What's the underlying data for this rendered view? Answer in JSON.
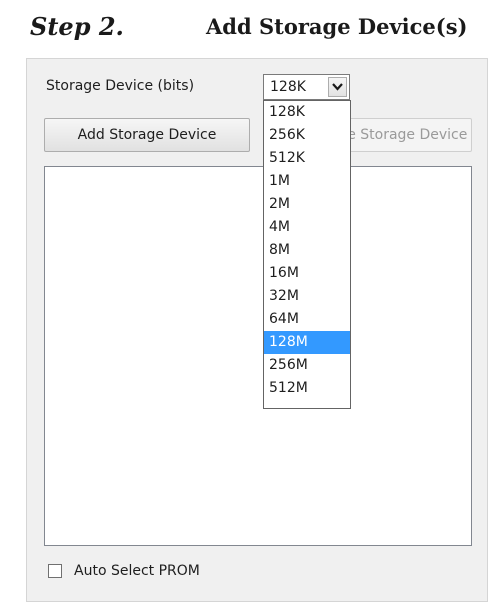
{
  "header": {
    "step": "Step 2.",
    "title": "Add Storage Device(s)"
  },
  "device_select": {
    "label": "Storage Device (bits)",
    "value": "128K",
    "options": [
      "128K",
      "256K",
      "512K",
      "1M",
      "2M",
      "4M",
      "8M",
      "16M",
      "32M",
      "64M",
      "128M",
      "256M",
      "512M"
    ],
    "highlighted": "128M"
  },
  "buttons": {
    "add": "Add Storage Device",
    "remove": "Remove Storage Device"
  },
  "auto_select": {
    "label": "Auto Select PROM",
    "checked": false
  },
  "colors": {
    "highlight": "#3399ff",
    "disabled_text": "#9a9a9a"
  }
}
